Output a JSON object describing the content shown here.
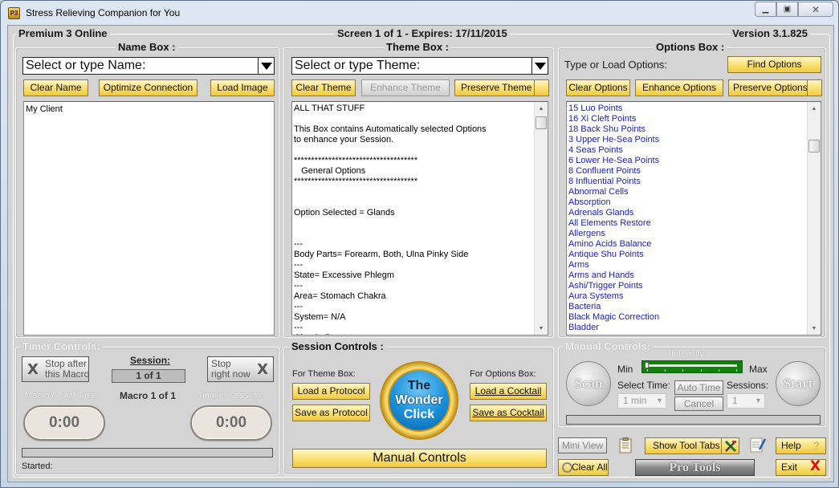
{
  "window": {
    "title": "Stress Relieving Companion for You",
    "app_icon": "P3",
    "controls": {
      "minimize": "minimize-icon",
      "maximize": "maximize-icon",
      "close": "close-icon"
    }
  },
  "header": {
    "edition": "Premium 3 Online",
    "screen_info": "Screen 1 of 1 - Expires: 17/11/2015",
    "version": "Version 3.1.825"
  },
  "name_box": {
    "title": "Name Box :",
    "combo_value": "Select or type Name:",
    "buttons": {
      "clear": "Clear Name",
      "optimize": "Optimize Connection",
      "load_image": "Load Image"
    },
    "content": "My Client"
  },
  "theme_box": {
    "title": "Theme Box :",
    "combo_value": "Select or type Theme:",
    "buttons": {
      "clear": "Clear Theme",
      "enhance": "Enhance Theme",
      "preserve": "Preserve Theme"
    },
    "lines": [
      "ALL THAT STUFF",
      "",
      "This Box contains Automatically selected Options",
      "to enhance your Session.",
      "",
      "************************************",
      "   General Options",
      "************************************",
      "",
      "",
      "Option Selected = Glands",
      "",
      "",
      "---",
      "Body Parts= Forearm, Both, Ulna Pinky Side",
      "---",
      "State= Excessive Phlegm",
      "---",
      "Area= Stomach Chakra",
      "---",
      "System= N/A",
      "---",
      "Gland= Prostate",
      "---"
    ]
  },
  "options_box": {
    "title": "Options Box :",
    "prompt": "Type or Load Options:",
    "buttons": {
      "find": "Find Options",
      "clear": "Clear Options",
      "enhance": "Enhance Options",
      "preserve": "Preserve Options"
    },
    "items": [
      "15 Luo Points",
      "16 Xi Cleft Points",
      "18 Back Shu Points",
      "3 Upper He-Sea Points",
      "4 Seas Points",
      "6 Lower He-Sea Points",
      "8 Confluent Points",
      "8 Influential Points",
      "Abnormal Cells",
      "Absorption",
      "Adrenals Glands",
      "All Elements Restore",
      "Allergens",
      "Amino Acids Balance",
      "Antique Shu Points",
      "Arms",
      "Arms and Hands",
      "Ashi/Trigger Points",
      "Aura Systems",
      "Bacteria",
      "Black Magic Correction",
      "Bladder"
    ],
    "item_color": "#1f22b5"
  },
  "timer_controls": {
    "title": "Timer Controls:",
    "stop_after_line1": "Stop after",
    "stop_after_line2": "this Macro",
    "stop_now_line1": "Stop",
    "stop_now_line2": "right now",
    "session_label": "Session:",
    "session_value": "1 of 1",
    "macro_info": "Macro 1 of 1",
    "macro_total_label": "Macro / Total Time:",
    "time_in_session_label": "Time in Session:",
    "macro_time": "0:00",
    "session_time": "0:00",
    "started_label": "Started:",
    "progress": 0
  },
  "session_controls": {
    "title": "Session Controls :",
    "theme_label": "For Theme Box:",
    "options_label": "For Options Box:",
    "load_protocol": "Load a Protocol",
    "save_protocol": "Save as Protocol",
    "load_cocktail": "Load a Cocktail",
    "save_cocktail": "Save as Cocktail",
    "wonder_line1": "The",
    "wonder_line2": "Wonder",
    "wonder_line3": "Click",
    "manual_controls": "Manual Controls"
  },
  "manual_controls": {
    "title": "Manual Controls:",
    "intensity_label": "Intensity:",
    "min_label": "Min",
    "max_label": "Max",
    "intensity_value": 0,
    "select_time_label": "Select Time:",
    "time_value": "1 min",
    "auto_time": "Auto Time",
    "cancel": "Cancel",
    "sessions_label": "Sessions:",
    "sessions_value": "1",
    "scan": "Scan",
    "start": "Start",
    "progress": 0
  },
  "bottom_bar": {
    "mini_view": "Mini View",
    "clear_all": "Clear All",
    "show_tool_tabs": "Show Tool Tabs",
    "pro_tools": "Pro Tools",
    "help": "Help",
    "help_icon": "?",
    "exit": "Exit",
    "exit_icon": "X"
  }
}
